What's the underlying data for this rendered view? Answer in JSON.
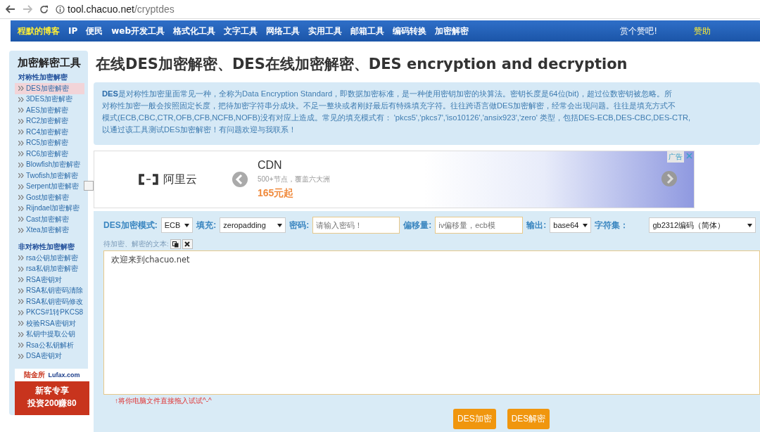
{
  "browser": {
    "url_host": "tool.chacuo.net",
    "url_path": "/cryptdes"
  },
  "nav": {
    "items": [
      {
        "label": "程默的博客",
        "highlighted": true
      },
      {
        "label": "IP",
        "highlighted": false
      },
      {
        "label": "便民",
        "highlighted": false
      },
      {
        "label": "web开发工具",
        "highlighted": false
      },
      {
        "label": "格式化工具",
        "highlighted": false
      },
      {
        "label": "文字工具",
        "highlighted": false
      },
      {
        "label": "网络工具",
        "highlighted": false
      },
      {
        "label": "实用工具",
        "highlighted": false
      },
      {
        "label": "邮箱工具",
        "highlighted": false
      },
      {
        "label": "编码转换",
        "highlighted": false
      },
      {
        "label": "加密解密",
        "highlighted": false
      }
    ],
    "right": [
      {
        "label": "赏个赞吧!",
        "highlighted": false
      },
      {
        "label": "赞助",
        "highlighted": true
      }
    ]
  },
  "sidebar": {
    "title": "加密解密工具",
    "groups": [
      {
        "heading": "对称性加密解密",
        "items": [
          {
            "label": "DES加密解密",
            "selected": true
          },
          {
            "label": "3DES加密解密",
            "selected": false
          },
          {
            "label": "AES加密解密",
            "selected": false
          },
          {
            "label": "RC2加密解密",
            "selected": false
          },
          {
            "label": "RC4加密解密",
            "selected": false
          },
          {
            "label": "RC5加密解密",
            "selected": false
          },
          {
            "label": "RC6加密解密",
            "selected": false
          },
          {
            "label": "Blowfish加密解密",
            "selected": false
          },
          {
            "label": "Twofish加密解密",
            "selected": false
          },
          {
            "label": "Serpent加密解密",
            "selected": false
          },
          {
            "label": "Gost加密解密",
            "selected": false
          },
          {
            "label": "Rijndael加密解密",
            "selected": false
          },
          {
            "label": "Cast加密解密",
            "selected": false
          },
          {
            "label": "Xtea加密解密",
            "selected": false
          }
        ]
      },
      {
        "heading": "非对称性加密解密",
        "items": [
          {
            "label": "rsa公钥加密解密",
            "selected": false
          },
          {
            "label": "rsa私钥加密解密",
            "selected": false
          },
          {
            "label": "RSA密钥对",
            "selected": false
          },
          {
            "label": "RSA私钥密码清除",
            "selected": false
          },
          {
            "label": "RSA私钥密码修改",
            "selected": false
          },
          {
            "label": "PKCS#1转PKCS8",
            "selected": false
          },
          {
            "label": "校验RSA密钥对",
            "selected": false
          },
          {
            "label": "私钥中提取公钥",
            "selected": false
          },
          {
            "label": "Rsa公私钥解析",
            "selected": false
          },
          {
            "label": "DSA密钥对",
            "selected": false
          }
        ]
      }
    ],
    "ad": {
      "brand": "陆金所",
      "site": "Lufax.com",
      "headline": "新客专享",
      "offer": "投资200赚80"
    }
  },
  "page_title": "在线DES加密解密、DES在线加密解密、DES encryption and decryption",
  "description": [
    "**DES**是对称性加密里面常见一种，全称为Data Encryption Standard，即数据加密标准，是一种使用密钥加密的块算法。密钥长度是64位(bit)，超过位数密钥被忽略。所",
    "对称性加密一般会按照固定长度，把待加密字符串分成块。不足一整块或者刚好最后有特殊填充字符。往往跨语言做DES加密解密，经常会出现问题。往往是填充方式不",
    "模式(ECB,CBC,CTR,OFB,CFB,NCFB,NOFB)没有对应上造成。常见的填充模式有： 'pkcs5','pkcs7','iso10126','ansix923','zero' 类型，包括DES-ECB,DES-CBC,DES-CTR,",
    "以通过该工具测试DES加密解密！有问题欢迎与我联系！"
  ],
  "banner": {
    "badge": "广告",
    "brand": "阿里云",
    "product": "CDN",
    "tagline": "500+节点，覆盖六大洲",
    "price": "165元起"
  },
  "form": {
    "fields": [
      {
        "kind": "select",
        "label": "DES加密模式:",
        "value": "ECB"
      },
      {
        "kind": "select",
        "label": "填充:",
        "value": "zeropadding"
      },
      {
        "kind": "input",
        "label": "密码:",
        "placeholder": "请输入密码！"
      },
      {
        "kind": "input",
        "label": "偏移量:",
        "placeholder": "iv偏移量，ecb模"
      },
      {
        "kind": "select",
        "label": "输出:",
        "value": "base64"
      },
      {
        "kind": "select",
        "label": "字符集：",
        "value": "gb2312编码（简体）"
      }
    ],
    "text_label": "待加密、解密的文本:",
    "text_value": "欢迎来到chacuo.net",
    "hint": "↑将你电脑文件直接拖入试试^-^",
    "buttons": [
      "DES加密",
      "DES解密"
    ]
  }
}
